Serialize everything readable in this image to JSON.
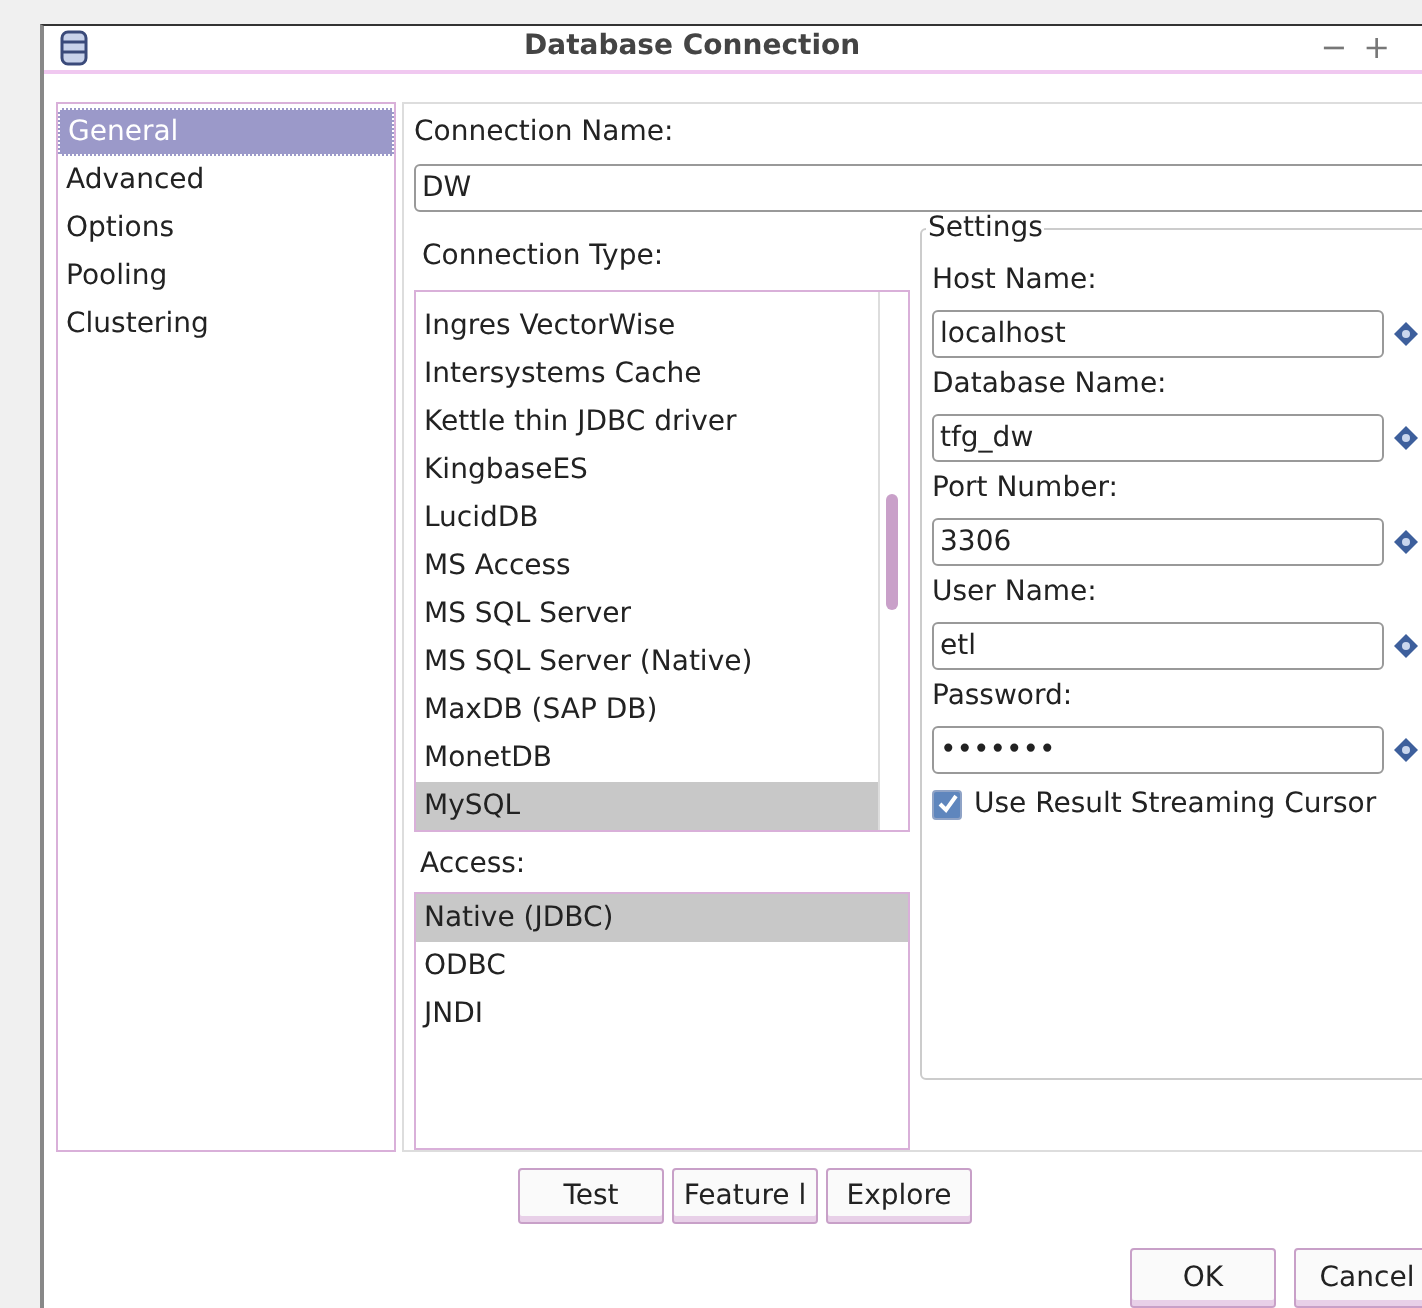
{
  "window": {
    "title": "Database Connection",
    "controls": [
      "−",
      "+"
    ]
  },
  "sidebar": {
    "items": [
      {
        "label": "General",
        "selected": true
      },
      {
        "label": "Advanced",
        "selected": false
      },
      {
        "label": "Options",
        "selected": false
      },
      {
        "label": "Pooling",
        "selected": false
      },
      {
        "label": "Clustering",
        "selected": false
      }
    ]
  },
  "connection_name": {
    "label": "Connection Name:",
    "value": "DW"
  },
  "connection_type": {
    "label": "Connection Type:",
    "items": [
      {
        "label": "Ingres VectorWise",
        "selected": false
      },
      {
        "label": "Intersystems Cache",
        "selected": false
      },
      {
        "label": "Kettle thin JDBC driver",
        "selected": false
      },
      {
        "label": "KingbaseES",
        "selected": false
      },
      {
        "label": "LucidDB",
        "selected": false
      },
      {
        "label": "MS Access",
        "selected": false
      },
      {
        "label": "MS SQL Server",
        "selected": false
      },
      {
        "label": "MS SQL Server (Native)",
        "selected": false
      },
      {
        "label": "MaxDB (SAP DB)",
        "selected": false
      },
      {
        "label": "MonetDB",
        "selected": false
      },
      {
        "label": "MySQL",
        "selected": true
      }
    ]
  },
  "access": {
    "label": "Access:",
    "items": [
      {
        "label": "Native (JDBC)",
        "selected": true
      },
      {
        "label": "ODBC",
        "selected": false
      },
      {
        "label": "JNDI",
        "selected": false
      }
    ]
  },
  "settings": {
    "title": "Settings",
    "fields": [
      {
        "label": "Host Name:",
        "value": "localhost"
      },
      {
        "label": "Database Name:",
        "value": "tfg_dw"
      },
      {
        "label": "Port Number:",
        "value": "3306"
      },
      {
        "label": "User Name:",
        "value": "etl"
      },
      {
        "label": "Password:",
        "value": "•••••••"
      }
    ],
    "checkbox": {
      "label": "Use Result Streaming Cursor",
      "checked": true
    }
  },
  "buttons": [
    "Test",
    "Feature l",
    "Explore"
  ],
  "dialog_buttons": [
    "OK",
    "Cancel"
  ]
}
